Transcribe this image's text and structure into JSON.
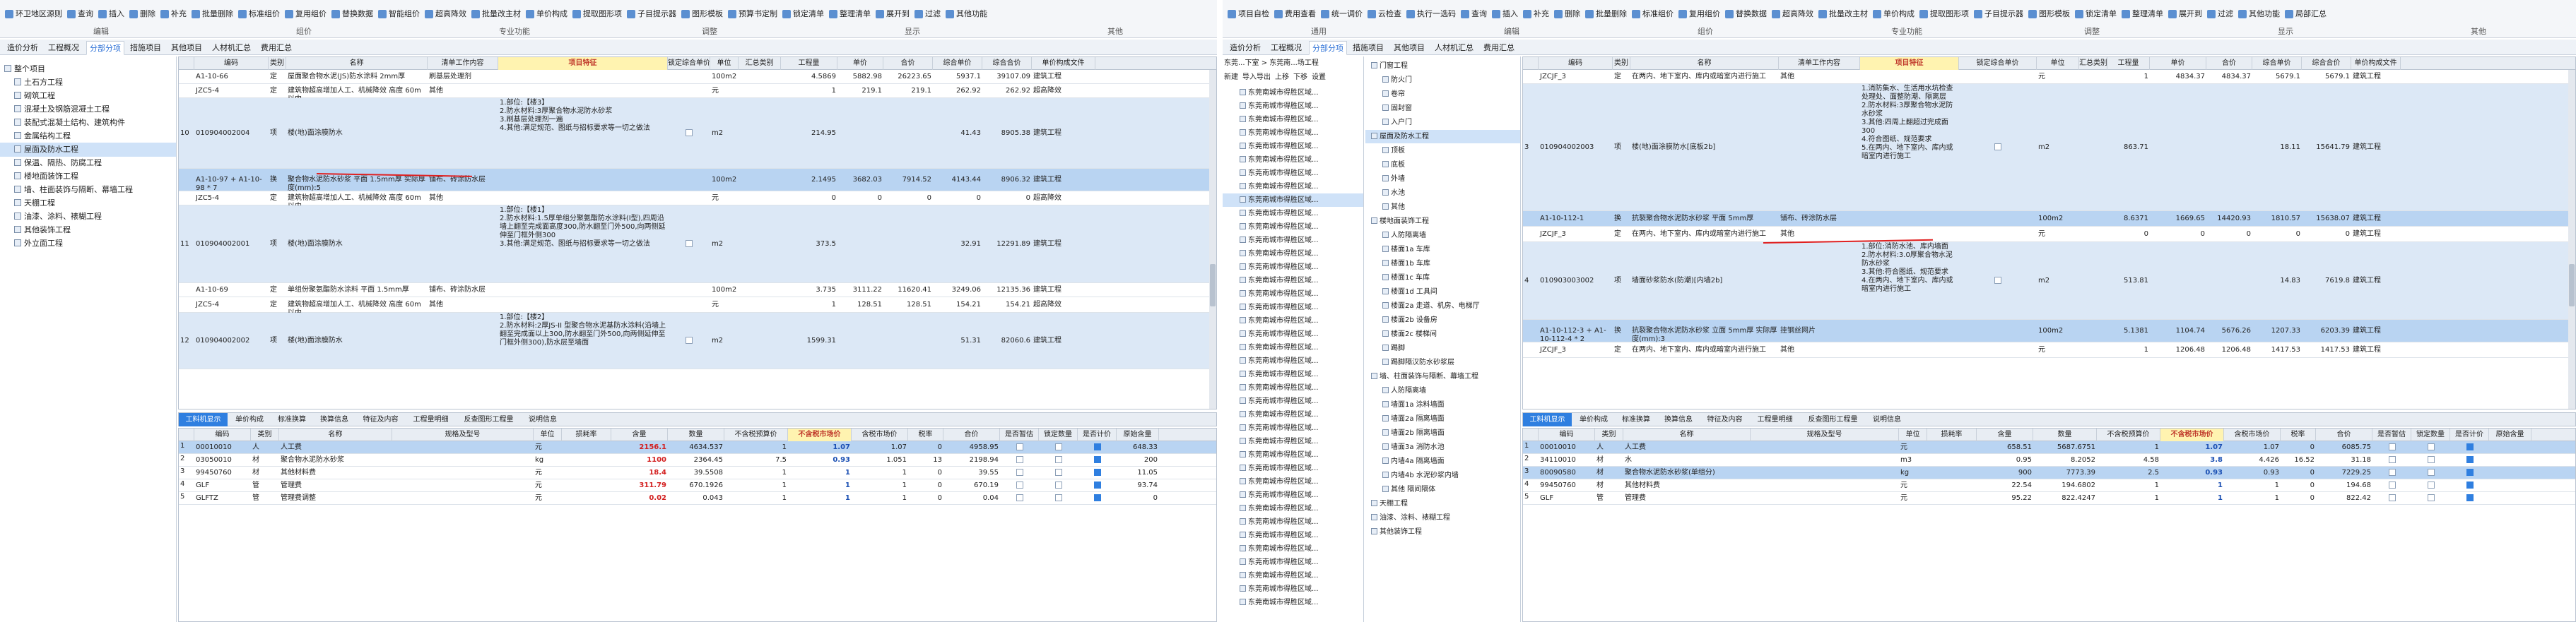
{
  "left": {
    "ribbon": {
      "buttons": [
        "环卫地区源则",
        "查询",
        "插入",
        "删除",
        "补充",
        "批量删除",
        "标准组价",
        "复用组价",
        "替换数据",
        "智能组价",
        "超高降效",
        "批量改主材",
        "单价构成",
        "提取图形项",
        "子目提示器",
        "图形模板",
        "预算书定制",
        "锁定清单",
        "整理清单",
        "展开到",
        "过滤",
        "其他功能"
      ],
      "groups": [
        "编辑",
        "组价",
        "专业功能",
        "调整",
        "显示",
        "其他"
      ]
    },
    "tabs": [
      "造价分析",
      "工程概况",
      "分部分项",
      "措施项目",
      "其他项目",
      "人材机汇总",
      "费用汇总"
    ],
    "active_tab": "分部分项",
    "tree": {
      "items": [
        "整个项目",
        "土石方工程",
        "砌筑工程",
        "混凝土及钢筋混凝土工程",
        "装配式混凝土结构、建筑构件",
        "金属结构工程",
        "屋面及防水工程",
        "保温、隔热、防腐工程",
        "楼地面装饰工程",
        "墙、柱面装饰与隔断、幕墙工程",
        "天棚工程",
        "油漆、涂料、裱糊工程",
        "其他装饰工程",
        "外立面工程"
      ],
      "selected": "屋面及防水工程"
    },
    "upper_grid": {
      "headers": [
        "编码",
        "类别",
        "名称",
        "清单工作内容",
        "项目特征",
        "锁定综合单价",
        "单位",
        "汇总类别",
        "工程量",
        "单价",
        "合价",
        "综合单价",
        "综合合价",
        "单价构成文件"
      ],
      "rows": [
        {
          "no": "",
          "code": "A1-10-66",
          "type": "定",
          "name": "屋面聚合物水泥(JS)防水涂料 2mm厚",
          "work": "刷基层处理剂",
          "feature": "",
          "unit": "100m2",
          "qty": "4.5869",
          "price": "5882.98",
          "total": "26223.65",
          "uprice": "5937.1",
          "utotal": "39107.09",
          "file": "建筑工程"
        },
        {
          "no": "",
          "code": "JZC5-4",
          "type": "定",
          "name": "建筑物超高增加人工、机械降效 高度 60m以内",
          "work": "其他",
          "feature": "",
          "unit": "元",
          "qty": "1",
          "price": "219.1",
          "total": "219.1",
          "uprice": "262.92",
          "utotal": "262.92",
          "file": "超高降效"
        },
        {
          "no": "10",
          "code": "010904002004",
          "type": "项",
          "name": "楼(地)面涂膜防水",
          "work": "",
          "feature": "1.部位:【楼3】\n2.防水材料:3厚聚合物水泥防水砂浆\n3.刷基层处理剂一遍\n4.其他:满足规范、图纸与招标要求等一切之做法",
          "unit": "m2",
          "qty": "214.95",
          "price": "",
          "total": "",
          "uprice": "41.43",
          "utotal": "8905.38",
          "file": "建筑工程"
        },
        {
          "no": "",
          "code": "A1-10-97 + A1-10-98 * 7",
          "type": "换",
          "name": "聚合物水泥防水砂浆 平面 1.5mm厚 实际厚度(mm):5",
          "work": "铺布、砖涂防水层",
          "feature": "",
          "unit": "100m2",
          "qty": "2.1495",
          "price": "3682.03",
          "total": "7914.52",
          "uprice": "4143.44",
          "utotal": "8906.32",
          "file": "建筑工程"
        },
        {
          "no": "",
          "code": "JZC5-4",
          "type": "定",
          "name": "建筑物超高增加人工、机械降效 高度 60m以内",
          "work": "其他",
          "feature": "",
          "unit": "元",
          "qty": "0",
          "price": "0",
          "total": "0",
          "uprice": "0",
          "utotal": "0",
          "file": "超高降效"
        },
        {
          "no": "11",
          "code": "010904002001",
          "type": "项",
          "name": "楼(地)面涂膜防水",
          "work": "",
          "feature": "1.部位:【楼1】\n2.防水材料:1.5厚单组分聚氨酯防水涂料(I型),四周沿墙上翻至完成面高度300,防水翻至门外500,向两侧延伸至门框外侧300\n3.其他:满足规范、图纸与招标要求等一切之做法",
          "unit": "m2",
          "qty": "373.5",
          "price": "",
          "total": "",
          "uprice": "32.91",
          "utotal": "12291.89",
          "file": "建筑工程"
        },
        {
          "no": "",
          "code": "A1-10-69",
          "type": "定",
          "name": "单组份聚氨酯防水涂料 平面 1.5mm厚",
          "work": "铺布、砖涂防水层",
          "feature": "",
          "unit": "100m2",
          "qty": "3.735",
          "price": "3111.22",
          "total": "11620.41",
          "uprice": "3249.06",
          "utotal": "12135.36",
          "file": "建筑工程"
        },
        {
          "no": "",
          "code": "JZC5-4",
          "type": "定",
          "name": "建筑物超高增加人工、机械降效 高度 60m以内",
          "work": "其他",
          "feature": "",
          "unit": "元",
          "qty": "1",
          "price": "128.51",
          "total": "128.51",
          "uprice": "154.21",
          "utotal": "154.21",
          "file": "超高降效"
        },
        {
          "no": "12",
          "code": "010904002002",
          "type": "项",
          "name": "楼(地)面涂膜防水",
          "work": "",
          "feature": "1.部位:【楼2】\n2.防水材料:2厚JS-II 型聚合物水泥基防水涂料(沿墙上翻至完成面以上300,防水翻至门外500,向两侧延伸至门框外侧300),防水层至墙面",
          "unit": "m2",
          "qty": "1599.31",
          "price": "",
          "total": "",
          "uprice": "51.31",
          "utotal": "82060.6",
          "file": "建筑工程"
        }
      ]
    },
    "bottom_tabs": [
      "工料机显示",
      "单价构成",
      "标准换算",
      "换算信息",
      "特征及内容",
      "工程量明细",
      "反查图形工程量",
      "说明信息"
    ],
    "lower_grid": {
      "headers": [
        "编码",
        "类别",
        "名称",
        "规格及型号",
        "单位",
        "损耗率",
        "含量",
        "数量",
        "不含税预算价",
        "不含税市场价",
        "含税市场价",
        "税率",
        "合价",
        "是否暂估",
        "锁定数量",
        "是否计价",
        "原始含量"
      ],
      "rows": [
        {
          "code": "00010010",
          "type": "人",
          "name": "人工费",
          "spec": "",
          "unit": "元",
          "loss": "",
          "content": "2156.1",
          "qty": "4634.537",
          "budget": "1",
          "market": "1.07",
          "tax_market": "1.07",
          "rate": "0",
          "total": "4958.95",
          "priced": true,
          "orig": "648.33"
        },
        {
          "code": "03050010",
          "type": "材",
          "name": "聚合物水泥防水砂浆",
          "spec": "",
          "unit": "kg",
          "loss": "",
          "content": "1100",
          "qty": "2364.45",
          "budget": "7.5",
          "market": "0.93",
          "tax_market": "1.051",
          "rate": "13",
          "total": "2198.94",
          "priced": true,
          "orig": "200"
        },
        {
          "code": "99450760",
          "type": "材",
          "name": "其他材料费",
          "spec": "",
          "unit": "元",
          "loss": "",
          "content": "18.4",
          "qty": "39.5508",
          "budget": "1",
          "market": "1",
          "tax_market": "1",
          "rate": "0",
          "total": "39.55",
          "priced": true,
          "orig": "11.05"
        },
        {
          "code": "GLF",
          "type": "管",
          "name": "管理费",
          "spec": "",
          "unit": "元",
          "loss": "",
          "content": "311.79",
          "qty": "670.1926",
          "budget": "1",
          "market": "1",
          "tax_market": "1",
          "rate": "0",
          "total": "670.19",
          "priced": true,
          "orig": "93.74"
        },
        {
          "code": "GLFTZ",
          "type": "管",
          "name": "管理费调整",
          "spec": "",
          "unit": "元",
          "loss": "",
          "content": "0.02",
          "qty": "0.043",
          "budget": "1",
          "market": "1",
          "tax_market": "1",
          "rate": "0",
          "total": "0.04",
          "priced": true,
          "orig": "0"
        }
      ]
    }
  },
  "right": {
    "ribbon": {
      "buttons": [
        "项目自检",
        "费用查看",
        "统一调价",
        "云检查",
        "执行一选码",
        "查询",
        "插入",
        "补充",
        "删除",
        "批量删除",
        "标准组价",
        "复用组价",
        "替换数据",
        "超高降效",
        "批量改主材",
        "单价构成",
        "提取图形项",
        "子目提示器",
        "图形模板",
        "锁定清单",
        "整理清单",
        "展开到",
        "过滤",
        "其他功能",
        "局部汇总"
      ],
      "groups": [
        "通用",
        "编辑",
        "组价",
        "专业功能",
        "调整",
        "显示",
        "其他"
      ]
    },
    "tabs": [
      "造价分析",
      "工程概况",
      "分部分项",
      "措施项目",
      "其他项目",
      "人材机汇总",
      "费用汇总"
    ],
    "active_tab": "分部分项",
    "path": [
      "东莞...下室",
      "东莞南...场工程"
    ],
    "toolbar": [
      "新建",
      "导入导出",
      "上移",
      "下移",
      "设置"
    ],
    "project_list": [
      "东莞南城市得胜区域...",
      "东莞南城市得胜区域...",
      "东莞南城市得胜区域...",
      "东莞南城市得胜区域...",
      "东莞南城市得胜区域...",
      "东莞南城市得胜区域...",
      "东莞南城市得胜区域...",
      "东莞南城市得胜区域...",
      "东莞南城市得胜区域...",
      "东莞南城市得胜区域...",
      "东莞南城市得胜区域...",
      "东莞南城市得胜区域...",
      "东莞南城市得胜区域...",
      "东莞南城市得胜区域...",
      "东莞南城市得胜区域...",
      "东莞南城市得胜区域...",
      "东莞南城市得胜区域...",
      "东莞南城市得胜区域...",
      "东莞南城市得胜区域...",
      "东莞南城市得胜区域...",
      "东莞南城市得胜区域...",
      "东莞南城市得胜区域...",
      "东莞南城市得胜区域...",
      "东莞南城市得胜区域...",
      "东莞南城市得胜区域...",
      "东莞南城市得胜区域...",
      "东莞南城市得胜区域...",
      "东莞南城市得胜区域...",
      "东莞南城市得胜区域...",
      "东莞南城市得胜区域...",
      "东莞南城市得胜区域...",
      "东莞南城市得胜区域...",
      "东莞南城市得胜区域...",
      "东莞南城市得胜区域...",
      "东莞南城市得胜区域...",
      "东莞南城市得胜区域...",
      "东莞南城市得胜区域...",
      "东莞南城市得胜区域...",
      "东莞南城市得胜区域..."
    ],
    "project_selected_index": 8,
    "tree": {
      "items": [
        "门窗工程",
        "防火门",
        "卷帘",
        "固封窗",
        "入户门",
        "屋面及防水工程",
        "顶板",
        "底板",
        "外墙",
        "水池",
        "其他",
        "楼地面装饰工程",
        "人防隔离墙",
        "楼面1a 车库",
        "楼面1b 车库",
        "楼面1c 车库",
        "楼面1d 工具间",
        "楼面2a 走道、机房、电梯厅",
        "楼面2b 设备房",
        "楼面2c 楼梯间",
        "踢脚",
        "踢脚隔汉防水砂浆层",
        "墙、柱面装饰与隔断、幕墙工程",
        "人防隔离墙",
        "墙面1a 涂料墙面",
        "墙面2a 隔离墙面",
        "墙面2b 隔离墙面",
        "墙面3a 消防水池",
        "内墙4a 隔离墙面",
        "内墙4b 水泥砂浆内墙",
        "其他 隔间隔体",
        "天棚工程",
        "油漆、涂料、裱糊工程",
        "其他装饰工程"
      ],
      "selected": "屋面及防水工程"
    },
    "upper_grid": {
      "headers": [
        "编码",
        "类别",
        "名称",
        "清单工作内容",
        "项目特征",
        "锁定综合单价",
        "单位",
        "汇总类别",
        "工程量",
        "单价",
        "合价",
        "综合单价",
        "综合合价",
        "单价构成文件"
      ],
      "rows": [
        {
          "no": "",
          "code": "JZCJF_3",
          "type": "定",
          "name": "在两内、地下室内、库内或暗室内进行施工",
          "work": "其他",
          "feature": "",
          "unit": "元",
          "qty": "1",
          "price": "4834.37",
          "total": "4834.37",
          "uprice": "5679.1",
          "utotal": "5679.1",
          "file": "建筑工程"
        },
        {
          "no": "3",
          "code": "010904002003",
          "type": "项",
          "name": "楼(地)面涂膜防水[底板2b]",
          "work": "",
          "feature": "1.消防集水、生活用水坑检查处理处、面整防潮、隔离层\n2.防水材料:3厚聚合物水泥防水砂浆\n3.其他:四周上翻超过完成面300\n4.符合图纸、规范要求\n5.在两内、地下室内、库内或暗室内进行施工",
          "unit": "m2",
          "qty": "863.71",
          "price": "",
          "total": "",
          "uprice": "18.11",
          "utotal": "15641.79",
          "file": "建筑工程"
        },
        {
          "no": "",
          "code": "A1-10-112-1",
          "type": "换",
          "name": "抗裂聚合物水泥防水砂浆 平面 5mm厚",
          "work": "铺布、砖涂防水层",
          "feature": "",
          "unit": "100m2",
          "qty": "8.6371",
          "price": "1669.65",
          "total": "14420.93",
          "uprice": "1810.57",
          "utotal": "15638.07",
          "file": "建筑工程"
        },
        {
          "no": "",
          "code": "JZCJF_3",
          "type": "定",
          "name": "在两内、地下室内、库内或暗室内进行施工",
          "work": "其他",
          "feature": "",
          "unit": "元",
          "qty": "0",
          "price": "0",
          "total": "0",
          "uprice": "0",
          "utotal": "0",
          "file": "建筑工程"
        },
        {
          "no": "4",
          "code": "010903003002",
          "type": "项",
          "name": "墙面砂浆防水(防潮)[内墙2b]",
          "work": "",
          "feature": "1.部位:消防水池、库内墙面\n2.防水材料:3.0厚聚合物水泥防水砂浆\n3.其他:符合图纸、规范要求\n4.在两内、地下室内、库内或暗室内进行施工",
          "unit": "m2",
          "qty": "513.81",
          "price": "",
          "total": "",
          "uprice": "14.83",
          "utotal": "7619.8",
          "file": "建筑工程"
        },
        {
          "no": "",
          "code": "A1-10-112-3 + A1-10-112-4 * 2",
          "type": "换",
          "name": "抗裂聚合物水泥防水砂浆 立面 5mm厚 实际厚度(mm):3",
          "work": "挂钢丝网片",
          "feature": "",
          "unit": "100m2",
          "qty": "5.1381",
          "price": "1104.74",
          "total": "5676.26",
          "uprice": "1207.33",
          "utotal": "6203.39",
          "file": "建筑工程"
        },
        {
          "no": "",
          "code": "JZCJF_3",
          "type": "定",
          "name": "在两内、地下室内、库内或暗室内进行施工",
          "work": "其他",
          "feature": "",
          "unit": "元",
          "qty": "1",
          "price": "1206.48",
          "total": "1206.48",
          "uprice": "1417.53",
          "utotal": "1417.53",
          "file": "建筑工程"
        }
      ]
    },
    "bottom_tabs": [
      "工料机显示",
      "单价构成",
      "标准换算",
      "换算信息",
      "特征及内容",
      "工程量明细",
      "反查图形工程量",
      "说明信息"
    ],
    "lower_grid": {
      "headers": [
        "编码",
        "类别",
        "名称",
        "规格及型号",
        "单位",
        "损耗率",
        "含量",
        "数量",
        "不含税预算价",
        "不含税市场价",
        "含税市场价",
        "税率",
        "合价",
        "是否暂估",
        "锁定数量",
        "是否计价",
        "原始含量"
      ],
      "rows": [
        {
          "code": "00010010",
          "type": "人",
          "name": "人工费",
          "spec": "",
          "unit": "元",
          "loss": "",
          "content": "658.51",
          "qty": "5687.6751",
          "budget": "1",
          "market": "1.07",
          "tax_market": "1.07",
          "rate": "0",
          "total": "6085.75",
          "priced": true,
          "orig": ""
        },
        {
          "code": "34110010",
          "type": "材",
          "name": "水",
          "spec": "",
          "unit": "m3",
          "loss": "",
          "content": "0.95",
          "qty": "8.2052",
          "budget": "4.58",
          "market": "3.8",
          "tax_market": "4.426",
          "rate": "16.52",
          "total": "31.18",
          "priced": true,
          "orig": ""
        },
        {
          "code": "80090580",
          "type": "材",
          "name": "聚合物水泥防水砂浆(单组分)",
          "spec": "",
          "unit": "kg",
          "loss": "",
          "content": "900",
          "qty": "7773.39",
          "budget": "2.5",
          "market": "0.93",
          "tax_market": "0.93",
          "rate": "0",
          "total": "7229.25",
          "priced": true,
          "orig": ""
        },
        {
          "code": "99450760",
          "type": "材",
          "name": "其他材料费",
          "spec": "",
          "unit": "元",
          "loss": "",
          "content": "22.54",
          "qty": "194.6802",
          "budget": "1",
          "market": "1",
          "tax_market": "1",
          "rate": "0",
          "total": "194.68",
          "priced": true,
          "orig": ""
        },
        {
          "code": "GLF",
          "type": "管",
          "name": "管理费",
          "spec": "",
          "unit": "元",
          "loss": "",
          "content": "95.22",
          "qty": "822.4247",
          "budget": "1",
          "market": "1",
          "tax_market": "1",
          "rate": "0",
          "total": "822.42",
          "priced": true,
          "orig": ""
        }
      ]
    }
  }
}
